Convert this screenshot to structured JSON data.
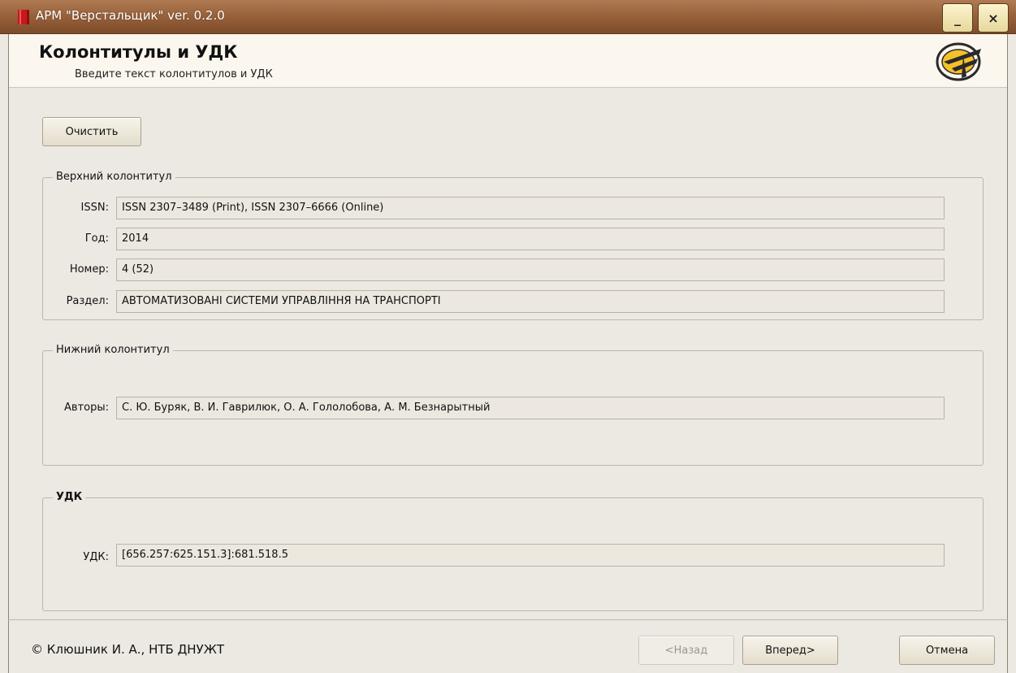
{
  "window": {
    "title": "АРМ \"Верстальщик\" ver. 0.2.0",
    "minimize_label": "_",
    "close_label": "×"
  },
  "header": {
    "title": "Колонтитулы и УДК",
    "subtitle": "Введите текст колонтитулов и УДК",
    "logo_icon": "railway-logo-icon"
  },
  "toolbar": {
    "clear_label": "Очистить"
  },
  "top_header_group": {
    "legend": "Верхний колонтитул",
    "fields": [
      {
        "label": "ISSN:",
        "value": "ISSN 2307–3489 (Print), ISSN 2307–6666 (Online)"
      },
      {
        "label": "Год:",
        "value": "2014"
      },
      {
        "label": "Номер:",
        "value": "4 (52)"
      },
      {
        "label": "Раздел:",
        "value": "АВТОМАТИЗОВАНІ СИСТЕМИ УПРАВЛІННЯ НА ТРАНСПОРТІ"
      }
    ]
  },
  "bottom_header_group": {
    "legend": "Нижний колонтитул",
    "authors_label": "Авторы:",
    "authors_value": "С. Ю. Буряк, В. И. Гаврилюк, О. А. Гололобова, А. М. Безнарытный"
  },
  "udk_group": {
    "legend": "УДК",
    "udk_label": "УДК:",
    "udk_value": "[656.257:625.151.3]:681.518.5"
  },
  "footer": {
    "copyright": "© Клюшник И. А., НТБ ДНУЖТ",
    "back_label": "<Назад",
    "next_label": "Вперед>",
    "cancel_label": "Отмена"
  },
  "colors": {
    "titlebar": "#96603a",
    "window_bg": "#ece9e3",
    "header_bg": "#fbf7ef"
  }
}
